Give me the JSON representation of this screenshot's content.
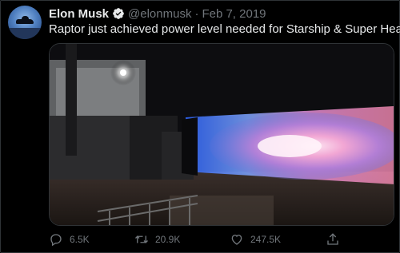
{
  "tweet": {
    "author_name": "Elon Musk",
    "handle": "@elonmusk",
    "separator": "·",
    "date": "Feb 7, 2019",
    "text": "Raptor just achieved power level needed for Starship & Super Heavy",
    "verified": true
  },
  "media": {
    "content": "rocket engine test fire with blue-pink exhaust plume at night"
  },
  "actions": {
    "reply_count": "6.5K",
    "retweet_count": "20.9K",
    "like_count": "247.5K"
  },
  "icons": {
    "reply": "reply-icon",
    "retweet": "retweet-icon",
    "like": "heart-icon",
    "share": "share-icon",
    "verified": "verified-badge-icon"
  },
  "colors": {
    "background": "#000000",
    "text_primary": "#e7e9ea",
    "text_secondary": "#71767b",
    "verified_badge": "#1d9bf0"
  }
}
